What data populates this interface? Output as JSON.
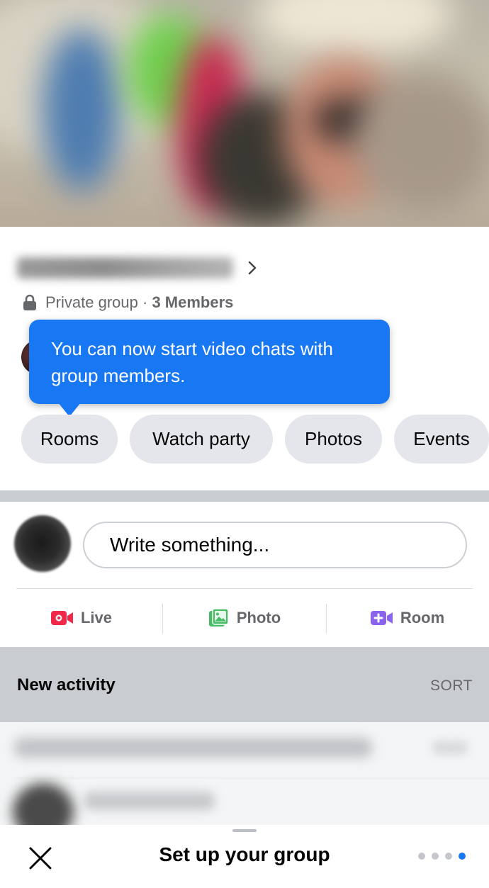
{
  "group": {
    "name_blurred": "",
    "privacy": "Private group",
    "separator": "·",
    "member_count": "3 Members"
  },
  "tooltip": {
    "line1": "You can now start video chats with",
    "line2": "group members."
  },
  "chips": [
    {
      "label": "Rooms"
    },
    {
      "label": "Watch party"
    },
    {
      "label": "Photos"
    },
    {
      "label": "Events"
    }
  ],
  "composer": {
    "placeholder": "Write something..."
  },
  "actions": [
    {
      "label": "Live",
      "icon": "live-video-icon",
      "color": "#f02849"
    },
    {
      "label": "Photo",
      "icon": "photo-icon",
      "color": "#45bd62"
    },
    {
      "label": "Room",
      "icon": "room-video-plus-icon",
      "color": "#8c63ed"
    }
  ],
  "activity": {
    "title": "New activity",
    "sort_label": "SORT"
  },
  "sheet": {
    "title": "Set up your group",
    "pages_total": 4,
    "current_page": 4
  },
  "colors": {
    "accent": "#1877f2",
    "chip_bg": "#e4e6eb",
    "muted_text": "#65676b"
  }
}
